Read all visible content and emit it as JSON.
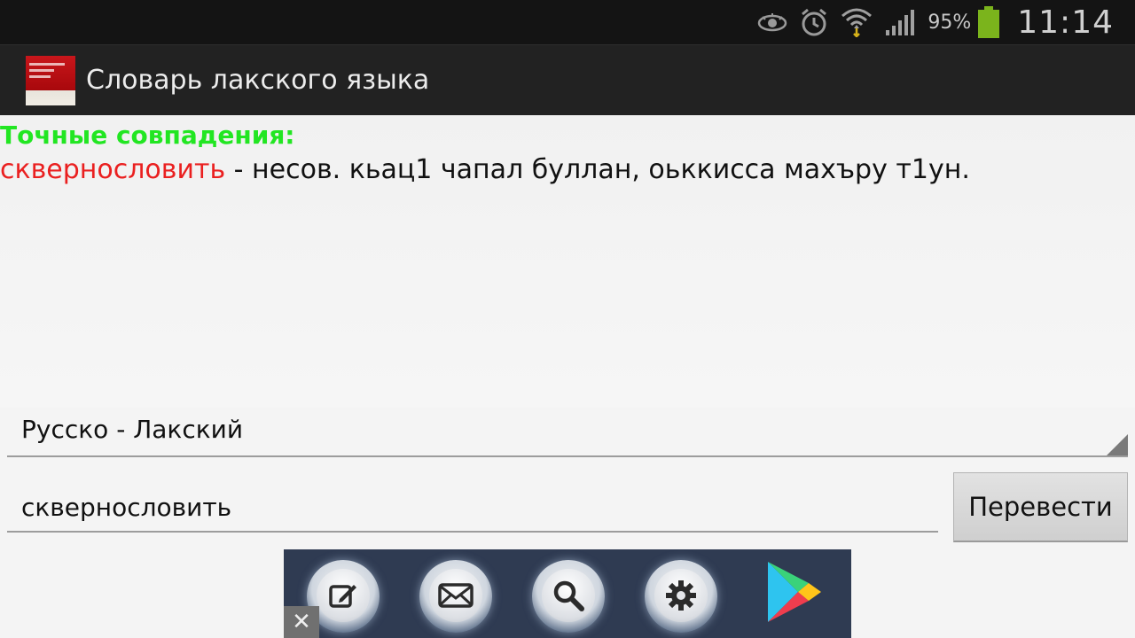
{
  "status_bar": {
    "battery_percent": "95%",
    "time": "11:14",
    "icons": [
      "eye-icon",
      "alarm-icon",
      "wifi-icon",
      "signal-icon",
      "battery-icon"
    ]
  },
  "app": {
    "title": "Словарь лакского языка",
    "icon": "dictionary-app-icon"
  },
  "results": {
    "header": "Точные совпадения:",
    "entries": [
      {
        "word": "сквернословить",
        "definition": " - несов. кьац1 чапал буллан, оьккисса махъру т1ун."
      }
    ]
  },
  "direction_spinner": {
    "selected": "Русско - Лакский"
  },
  "search": {
    "value": "сквернословить",
    "translate_label": "Перевести"
  },
  "ad_dock": {
    "items": [
      "edit-icon",
      "mail-icon",
      "search-icon",
      "gear-icon",
      "play-store-icon"
    ],
    "close_label": "✕"
  },
  "colors": {
    "header_green": "#22e622",
    "word_red": "#ea2020",
    "actionbar": "#222222",
    "statusbar": "#141414"
  }
}
